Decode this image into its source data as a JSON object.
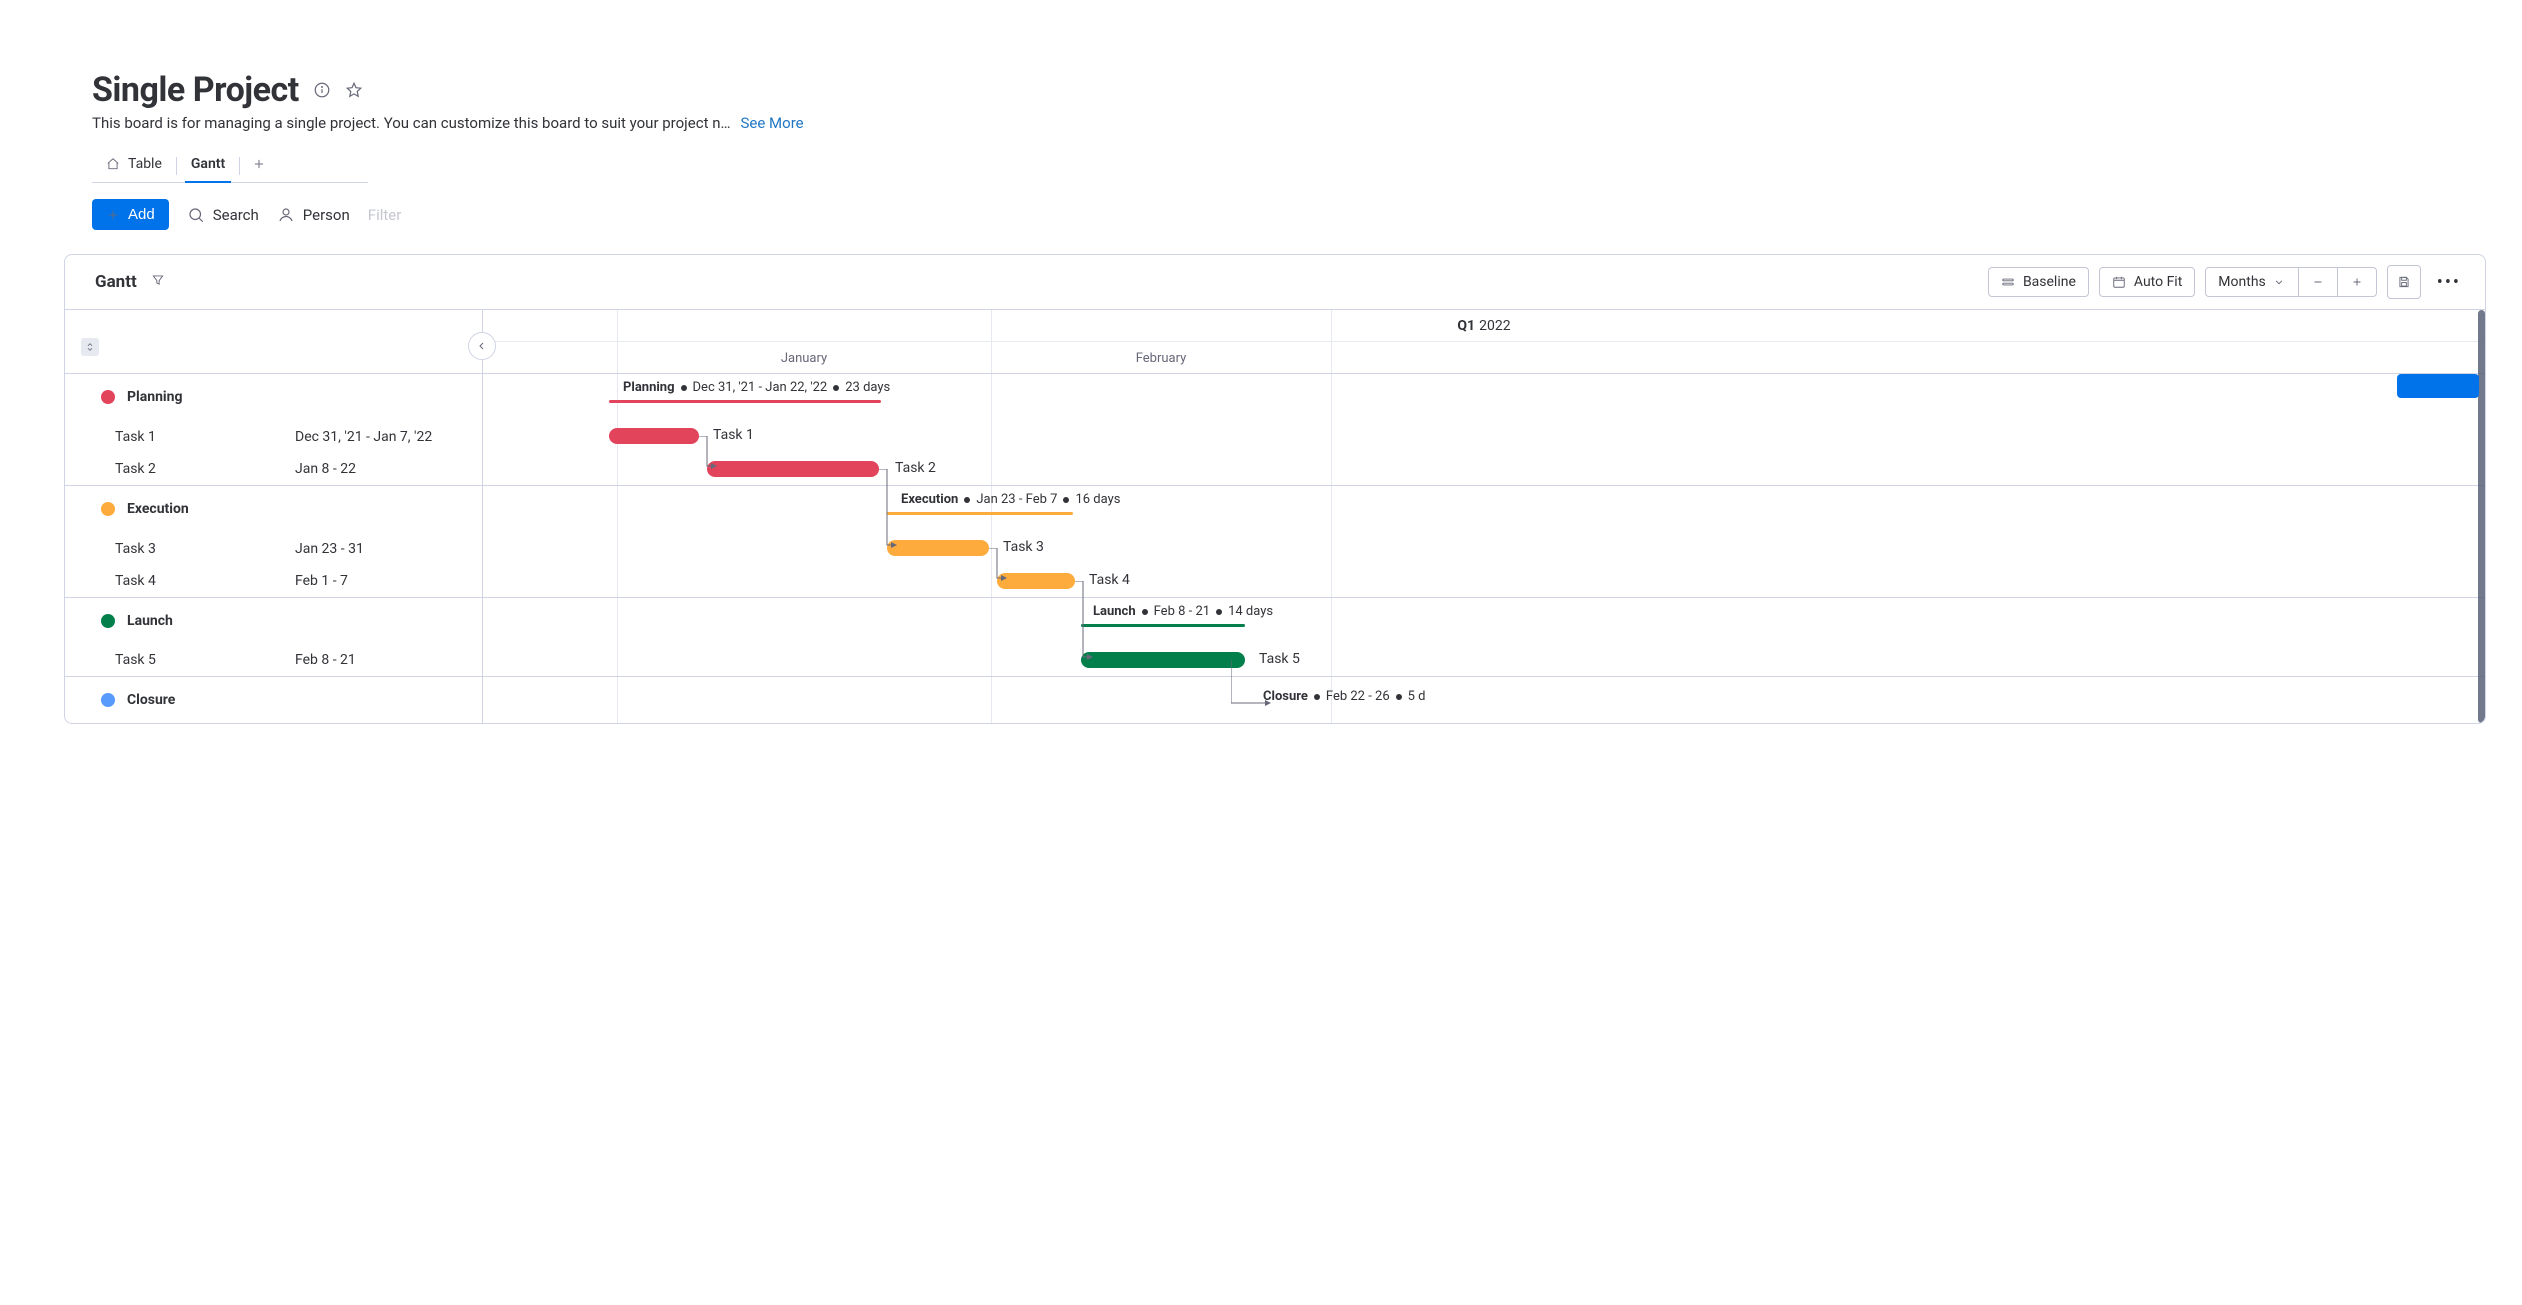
{
  "header": {
    "title": "Single Project",
    "description": "This board is for managing a single project. You can customize this board to suit your project n…",
    "see_more": "See More"
  },
  "tabs": {
    "table": "Table",
    "gantt": "Gantt"
  },
  "toolbar": {
    "add": "Add",
    "search": "Search",
    "person": "Person",
    "filter": "Filter"
  },
  "gantt_header": {
    "title": "Gantt",
    "baseline": "Baseline",
    "autofit": "Auto Fit",
    "scale": "Months"
  },
  "timeline": {
    "quarter_prefix": "Q1",
    "quarter_year": "2022",
    "months": {
      "jan": "January",
      "feb": "February"
    }
  },
  "groups": [
    {
      "name": "Planning",
      "color": "#e2445c",
      "summary_dates": "Dec 31, '21 - Jan 22, '22",
      "summary_duration": "23 days",
      "tasks": [
        {
          "name": "Task 1",
          "dates": "Dec 31, '21 - Jan 7, '22"
        },
        {
          "name": "Task 2",
          "dates": "Jan 8 - 22"
        }
      ]
    },
    {
      "name": "Execution",
      "color": "#fdab3d",
      "summary_dates": "Jan 23 - Feb 7",
      "summary_duration": "16 days",
      "tasks": [
        {
          "name": "Task 3",
          "dates": "Jan 23 - 31"
        },
        {
          "name": "Task 4",
          "dates": "Feb 1 - 7"
        }
      ]
    },
    {
      "name": "Launch",
      "color": "#037f4c",
      "summary_dates": "Feb 8 - 21",
      "summary_duration": "14 days",
      "tasks": [
        {
          "name": "Task 5",
          "dates": "Feb 8 - 21"
        }
      ]
    },
    {
      "name": "Closure",
      "color": "#579bfc",
      "summary_dates": "Feb 22 - 26",
      "summary_duration": "5 d",
      "tasks": []
    }
  ],
  "chart_data": {
    "type": "bar",
    "title": "Gantt — Single Project",
    "x_axis": {
      "unit": "date",
      "range": [
        "2021-12-20",
        "2022-03-05"
      ],
      "labels": [
        "January",
        "February"
      ],
      "header": "Q1 2022"
    },
    "groups": [
      {
        "name": "Planning",
        "color": "#e2445c",
        "start": "2021-12-31",
        "end": "2022-01-22",
        "duration_days": 23
      },
      {
        "name": "Execution",
        "color": "#fdab3d",
        "start": "2022-01-23",
        "end": "2022-02-07",
        "duration_days": 16
      },
      {
        "name": "Launch",
        "color": "#037f4c",
        "start": "2022-02-08",
        "end": "2022-02-21",
        "duration_days": 14
      },
      {
        "name": "Closure",
        "color": "#579bfc",
        "start": "2022-02-22",
        "end": "2022-02-26",
        "duration_days": 5
      }
    ],
    "tasks": [
      {
        "name": "Task 1",
        "group": "Planning",
        "start": "2021-12-31",
        "end": "2022-01-07"
      },
      {
        "name": "Task 2",
        "group": "Planning",
        "start": "2022-01-08",
        "end": "2022-01-22"
      },
      {
        "name": "Task 3",
        "group": "Execution",
        "start": "2022-01-23",
        "end": "2022-01-31"
      },
      {
        "name": "Task 4",
        "group": "Execution",
        "start": "2022-02-01",
        "end": "2022-02-07"
      },
      {
        "name": "Task 5",
        "group": "Launch",
        "start": "2022-02-08",
        "end": "2022-02-21"
      }
    ],
    "dependencies": [
      [
        "Task 1",
        "Task 2"
      ],
      [
        "Task 2",
        "Task 3"
      ],
      [
        "Task 3",
        "Task 4"
      ],
      [
        "Task 4",
        "Task 5"
      ],
      [
        "Task 5",
        "Closure"
      ]
    ]
  }
}
